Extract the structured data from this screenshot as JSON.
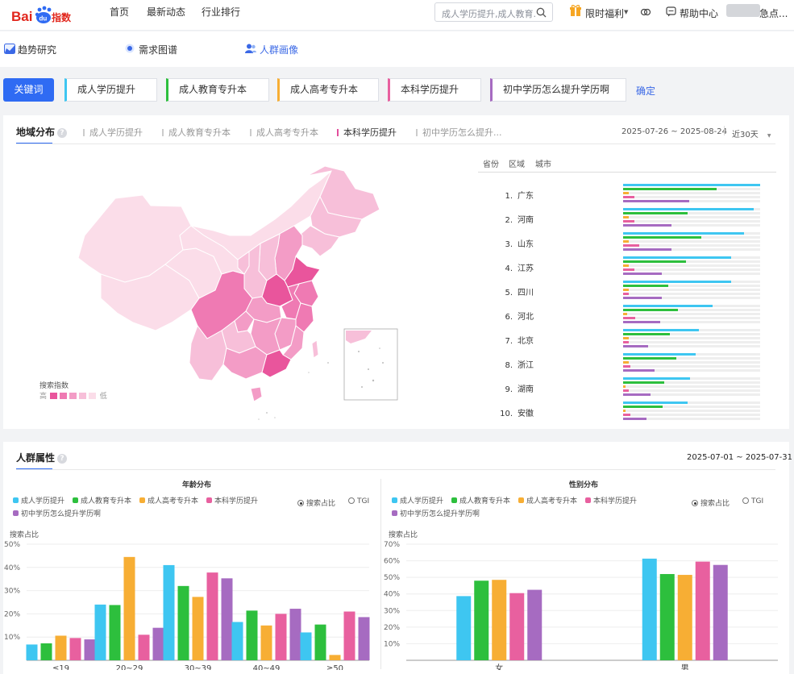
{
  "header": {
    "logo": "Baidu指数",
    "nav": [
      "首页",
      "最新动态",
      "行业排行"
    ],
    "search_placeholder": "成人学历提升,成人教育...",
    "offer": "限时福利",
    "help": "帮助中心",
    "user": "急点..."
  },
  "subnav": [
    {
      "label": "趋势研究",
      "icon": "trend-icon"
    },
    {
      "label": "需求图谱",
      "icon": "graph-icon"
    },
    {
      "label": "人群画像",
      "icon": "crowd-icon",
      "active": true
    }
  ],
  "keywords": {
    "label": "关键词",
    "confirm": "确定",
    "items": [
      {
        "label": "成人学历提升",
        "color": "#3ec6f1"
      },
      {
        "label": "成人教育专升本",
        "color": "#2dbf3d"
      },
      {
        "label": "成人高考专升本",
        "color": "#f7ae34"
      },
      {
        "label": "本科学历提升",
        "color": "#e8609f"
      },
      {
        "label": "初中学历怎么提升学历啊",
        "color": "#a66bc1"
      }
    ]
  },
  "region": {
    "title": "地域分布",
    "tabs": [
      "成人学历提升",
      "成人教育专升本",
      "成人高考专升本",
      "本科学历提升",
      "初中学历怎么提升..."
    ],
    "active_tab": 3,
    "date_range": "2025-07-26 ~ 2025-08-24",
    "period": "近30天",
    "scope_tabs": [
      "省份",
      "区域",
      "城市"
    ],
    "legend": {
      "title": "搜索指数",
      "high": "高",
      "low": "低",
      "colors": [
        "#e9559c",
        "#ef7ab3",
        "#f39cc6",
        "#f7bfd9",
        "#fbdde9"
      ]
    },
    "ranking": [
      {
        "rank": "1.",
        "name": "广东",
        "values": [
          1.0,
          0.68,
          0.04,
          0.08,
          0.48
        ]
      },
      {
        "rank": "2.",
        "name": "河南",
        "values": [
          0.95,
          0.47,
          0.04,
          0.08,
          0.35
        ]
      },
      {
        "rank": "3.",
        "name": "山东",
        "values": [
          0.88,
          0.57,
          0.04,
          0.12,
          0.35
        ]
      },
      {
        "rank": "4.",
        "name": "江苏",
        "values": [
          0.79,
          0.46,
          0.04,
          0.08,
          0.28
        ]
      },
      {
        "rank": "5.",
        "name": "四川",
        "values": [
          0.79,
          0.33,
          0.04,
          0.04,
          0.28
        ]
      },
      {
        "rank": "6.",
        "name": "河北",
        "values": [
          0.65,
          0.4,
          0.03,
          0.09,
          0.27
        ]
      },
      {
        "rank": "7.",
        "name": "北京",
        "values": [
          0.55,
          0.34,
          0.04,
          0.04,
          0.18
        ]
      },
      {
        "rank": "8.",
        "name": "浙江",
        "values": [
          0.53,
          0.39,
          0.04,
          0.05,
          0.23
        ]
      },
      {
        "rank": "9.",
        "name": "湖南",
        "values": [
          0.49,
          0.3,
          0.02,
          0.04,
          0.2
        ]
      },
      {
        "rank": "10.",
        "name": "安徽",
        "values": [
          0.47,
          0.29,
          0.02,
          0.05,
          0.17
        ]
      }
    ]
  },
  "crowd": {
    "title": "人群属性",
    "date_range": "2025-07-01 ~ 2025-07-31",
    "radio": [
      "搜索占比",
      "TGI"
    ]
  },
  "chart_data": [
    {
      "type": "bar",
      "title": "年龄分布",
      "ylabel": "搜索占比",
      "categories": [
        "≤19",
        "20~29",
        "30~39",
        "40~49",
        "≥50"
      ],
      "yticks": [
        "10%",
        "20%",
        "30%",
        "40%",
        "50%"
      ],
      "ylim": [
        0,
        50
      ],
      "series": [
        {
          "name": "成人学历提升",
          "color": "#3ec6f1",
          "values": [
            6.8,
            24,
            41,
            16.5,
            12
          ]
        },
        {
          "name": "成人教育专升本",
          "color": "#2dbf3d",
          "values": [
            7.3,
            23.8,
            32,
            21.4,
            15.4
          ]
        },
        {
          "name": "成人高考专升本",
          "color": "#f7ae34",
          "values": [
            10.6,
            44.5,
            27.3,
            15,
            2.3
          ]
        },
        {
          "name": "本科学历提升",
          "color": "#e8609f",
          "values": [
            9.6,
            11,
            37.8,
            20,
            21
          ]
        },
        {
          "name": "初中学历怎么提升学历啊",
          "color": "#a66bc1",
          "values": [
            9,
            14,
            35.3,
            22.2,
            18.6
          ]
        }
      ]
    },
    {
      "type": "bar",
      "title": "性别分布",
      "ylabel": "搜索占比",
      "categories": [
        "女",
        "男"
      ],
      "yticks": [
        "10%",
        "20%",
        "30%",
        "40%",
        "50%",
        "60%",
        "70%"
      ],
      "ylim": [
        0,
        70
      ],
      "series": [
        {
          "name": "成人学历提升",
          "color": "#3ec6f1",
          "values": [
            38.7,
            61.3
          ]
        },
        {
          "name": "成人教育专升本",
          "color": "#2dbf3d",
          "values": [
            48,
            52
          ]
        },
        {
          "name": "成人高考专升本",
          "color": "#f7ae34",
          "values": [
            48.5,
            51.5
          ]
        },
        {
          "name": "本科学历提升",
          "color": "#e8609f",
          "values": [
            40.5,
            59.5
          ]
        },
        {
          "name": "初中学历怎么提升学历啊",
          "color": "#a66bc1",
          "values": [
            42.5,
            57.5
          ]
        }
      ]
    }
  ]
}
